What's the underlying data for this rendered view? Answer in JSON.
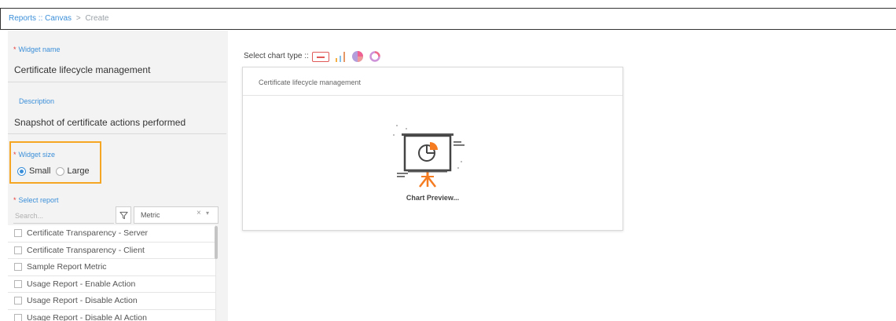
{
  "breadcrumb": {
    "items": [
      "Reports",
      "Canvas",
      "Create"
    ],
    "separators": [
      " :: ",
      " > "
    ]
  },
  "form": {
    "widget_name": {
      "label": "Widget name",
      "value": "Certificate lifecycle management"
    },
    "description": {
      "label": "Description",
      "value": "Snapshot of certificate actions performed"
    },
    "widget_size": {
      "label": "Widget size",
      "options": [
        "Small",
        "Large"
      ],
      "selected": "Small"
    },
    "select_report": {
      "label": "Select report",
      "search_placeholder": "Search...",
      "filter_value": "Metric",
      "clear_glyph": "×",
      "caret_glyph": "▾",
      "items": [
        "Certificate Transparency - Server",
        "Certificate Transparency - Client",
        "Sample Report Metric",
        "Usage Report - Enable Action",
        "Usage Report - Disable Action",
        "Usage Report - Disable AI Action"
      ]
    }
  },
  "chart_type": {
    "label": "Select chart type ::",
    "options": [
      "table-icon",
      "bar-chart-icon",
      "pie-chart-icon",
      "donut-chart-icon"
    ]
  },
  "preview": {
    "title": "Certificate lifecycle management",
    "caption": "Chart Preview..."
  },
  "colors": {
    "accent_blue": "#3b8fd9",
    "highlight_orange": "#f5a623",
    "required_red": "#e53935",
    "illustration_orange": "#f57c20"
  }
}
